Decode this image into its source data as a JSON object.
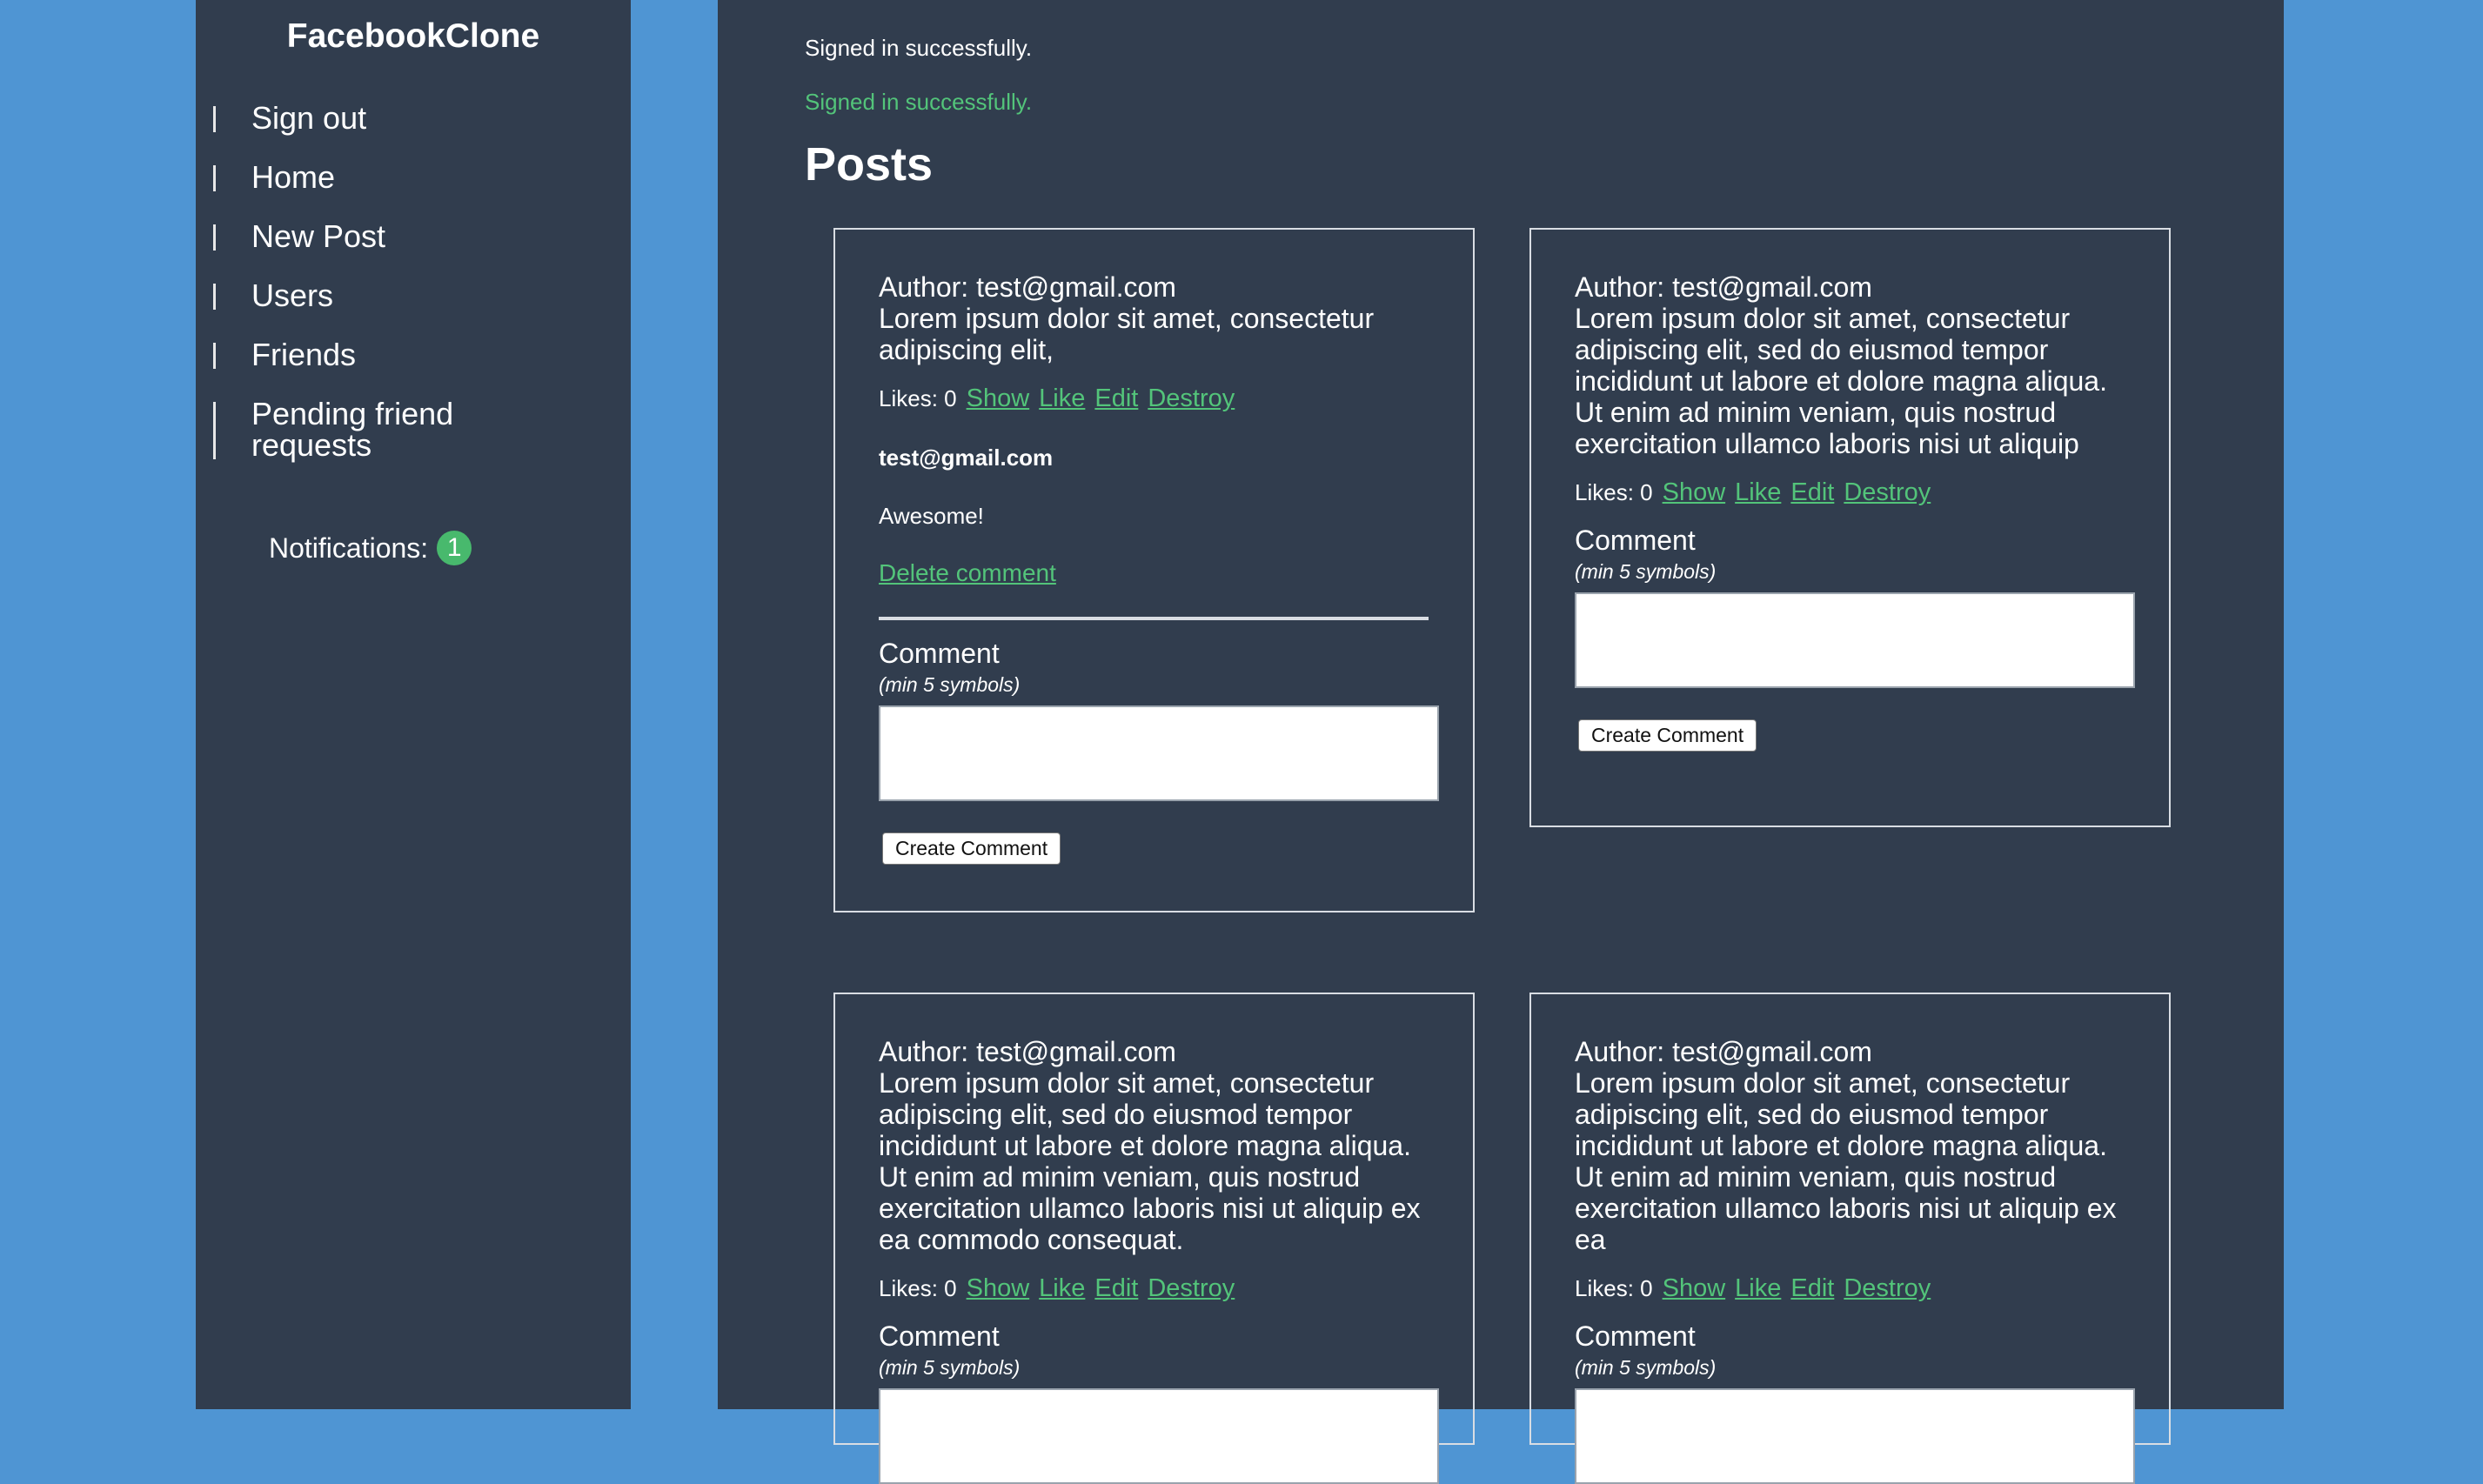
{
  "app": {
    "title": "FacebookClone"
  },
  "nav": {
    "sign_out": "Sign out",
    "home": "Home",
    "new_post": "New Post",
    "users": "Users",
    "friends": "Friends",
    "pending": "Pending friend requests"
  },
  "notifications": {
    "label": "Notifications:",
    "count": "1"
  },
  "flash": {
    "notice": "Signed in successfully.",
    "success": "Signed in successfully."
  },
  "page": {
    "title": "Posts"
  },
  "labels": {
    "likes": "Likes: 0",
    "show": "Show",
    "like": "Like",
    "edit": "Edit",
    "destroy": "Destroy",
    "comment": "Comment",
    "hint": "(min 5 symbols)",
    "create_comment": "Create Comment",
    "delete_comment": "Delete comment"
  },
  "posts": [
    {
      "author": "Author: test@gmail.com",
      "body": "Lorem ipsum dolor sit amet, consectetur adipiscing elit,",
      "comment_author": "test@gmail.com",
      "comment_text": "Awesome!"
    },
    {
      "author": "Author: test@gmail.com",
      "body": "Lorem ipsum dolor sit amet, consectetur adipiscing elit, sed do eiusmod tempor incididunt ut labore et dolore magna aliqua. Ut enim ad minim veniam, quis nostrud exercitation ullamco laboris nisi ut aliquip"
    },
    {
      "author": "Author: test@gmail.com",
      "body": "Lorem ipsum dolor sit amet, consectetur adipiscing elit, sed do eiusmod tempor incididunt ut labore et dolore magna aliqua. Ut enim ad minim veniam, quis nostrud exercitation ullamco laboris nisi ut aliquip ex ea commodo consequat."
    },
    {
      "author": "Author: test@gmail.com",
      "body": "Lorem ipsum dolor sit amet, consectetur adipiscing elit, sed do eiusmod tempor incididunt ut labore et dolore magna aliqua. Ut enim ad minim veniam, quis nostrud exercitation ullamco laboris nisi ut aliquip ex ea"
    }
  ],
  "colors": {
    "background": "#4f95d3",
    "panel": "#313d4e",
    "link": "#53c47a"
  }
}
